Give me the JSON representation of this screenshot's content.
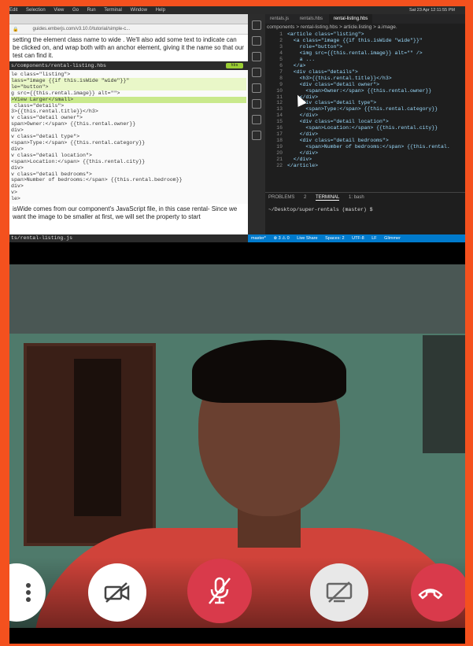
{
  "menubar": {
    "items": [
      "Edit",
      "Selection",
      "View",
      "Go",
      "Run",
      "Terminal",
      "Window",
      "Help"
    ],
    "status": "Sat 23 Apr  12:11:55 PM"
  },
  "browser": {
    "url": "guides.emberjs.com/v3.10.0/tutorial/simple-c...",
    "intro": "setting the element class name to wide . We'll also add some text to indicate can be clicked on, and wrap both with an anchor element, giving it the name so that our test can find it.",
    "file_header": "s/components/rental-listing.hbs",
    "badge": "hbs",
    "code": [
      "le class=\"listing\">",
      "lass=\"image {{if this.isWide \"wide\"}}\"",
      "le=\"button\">",
      "g src={{this.rental.image}} alt=\"\">",
      ">View Larger</small>",
      "",
      " class=\"details\">",
      "3>{{this.rental.title}}</h3>",
      "v class=\"detail owner\">",
      "span>Owner:</span> {{this.rental.owner}}",
      "div>",
      "v class=\"detail type\">",
      "<span>Type:</span> {{this.rental.category}}",
      "div>",
      "v class=\"detail location\">",
      "<span>Location:</span> {{this.rental.city}}",
      "div>",
      "v class=\"detail bedrooms\">",
      "span>Number of bedrooms:</span> {{this.rental.bedroom}}",
      "div>",
      "v>",
      "le>"
    ],
    "note": "isWide  comes from our component's JavaScript file, in this case  rental- Since we want the image to be smaller at first, we will set the property to start",
    "footer_file": "ts/rental-listing.js"
  },
  "editor": {
    "tabs": [
      "rentals.js",
      "rentals.hbs",
      "rental-listing.hbs"
    ],
    "breadcrumb": "components > rental-listing.hbs > article.listing > a.image.",
    "lines": [
      "<article class=\"listing\">",
      "  <a class=\"image {{if this.isWide \"wide\"}}\"",
      "    role=\"button\">",
      "    <img src={{this.rental.image}} alt=\"\" />",
      "    a ...",
      "  </a>",
      "  <div class=\"details\">",
      "    <h3>{{this.rental.title}}</h3>",
      "    <div class=\"detail owner\">",
      "      <span>Owner:</span> {{this.rental.owner}}",
      "    </div>",
      "    <div class=\"detail type\">",
      "      <span>Type:</span> {{this.rental.category}}",
      "    </div>",
      "    <div class=\"detail location\">",
      "      <span>Location:</span> {{this.rental.city}}",
      "    </div>",
      "    <div class=\"detail bedrooms\">",
      "      <span>Number of bedrooms:</span> {{this.rental.",
      "    </div>",
      "  </div>",
      "</article>"
    ],
    "line_numbers": [
      "1",
      "2",
      "3",
      "4",
      "5",
      "6",
      "7",
      "8",
      "9",
      "10",
      "11",
      "12",
      "13",
      "14",
      "15",
      "16",
      "17",
      "18",
      "19",
      "20",
      "21",
      "22"
    ],
    "panel_tabs": [
      "PROBLEMS",
      "TERMINAL",
      "1: bash"
    ],
    "problems_count": "2",
    "terminal_line": "~/Desktop/super-rentals  (master) $",
    "statusbar": [
      "master*",
      "⊗ 3 ⚠ 0",
      "Live Share",
      "Spaces: 2",
      "UTF-8",
      "LF",
      "Glimmer"
    ]
  },
  "dock": {
    "colors": [
      "#4a90d9",
      "#e74c3c",
      "#3498db",
      "#1e88e5",
      "#8e44ad",
      "#a0522d",
      "#e67e22",
      "#f1c40f",
      "#ecf0f1",
      "#2ecc71",
      "#9b59b6",
      "#1abc9c",
      "#34495e",
      "#3498db",
      "#2980b9",
      "#555555",
      "#e67e22",
      "#27ae60",
      "#2c3e50",
      "#f39c12",
      "#c0392b",
      "#7f8c8d",
      "#95a5a6"
    ]
  },
  "call_controls": {
    "more_icon": "more-vertical-icon",
    "camera_icon": "camera-off-icon",
    "mic_icon": "mic-off-icon",
    "share_icon": "screen-share-off-icon",
    "end_icon": "end-call-icon",
    "accent": "#d93a4b"
  }
}
